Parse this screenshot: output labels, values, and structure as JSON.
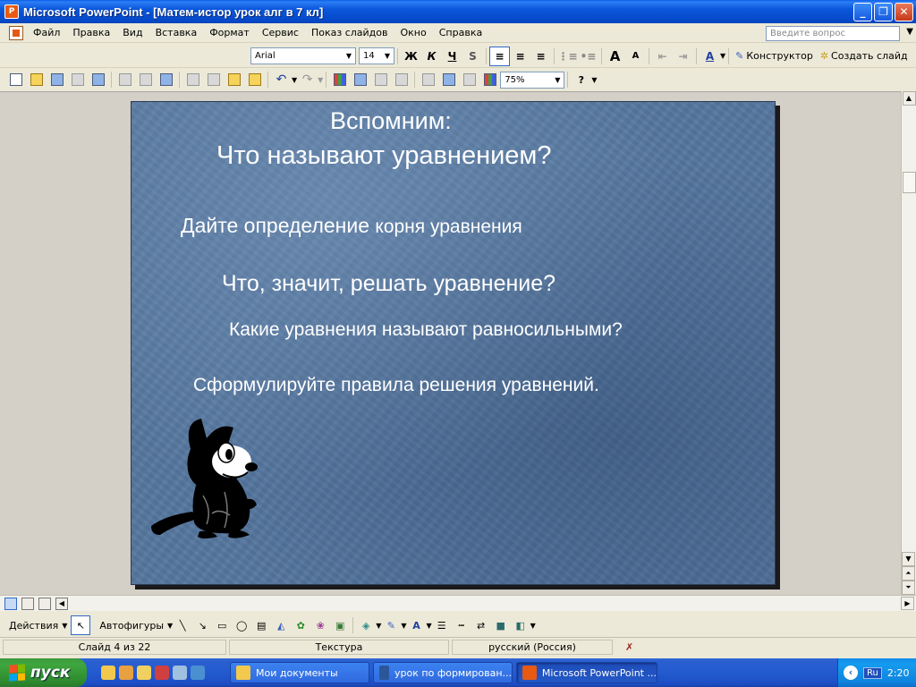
{
  "window": {
    "title": "Microsoft PowerPoint - [Матем-истор урок алг в 7 кл]",
    "buttons": {
      "minimize": "_",
      "maximize": "❐",
      "close": "✕"
    }
  },
  "menu": {
    "items": [
      "Файл",
      "Правка",
      "Вид",
      "Вставка",
      "Формат",
      "Сервис",
      "Показ слайдов",
      "Окно",
      "Справка"
    ],
    "help_placeholder": "Введите вопрос"
  },
  "format_toolbar": {
    "font": "Arial",
    "size": "14",
    "bold": "Ж",
    "italic": "К",
    "underline": "Ч",
    "shadow": "S",
    "font_color": "A",
    "designer": "Конструктор",
    "new_slide": "Создать слайд"
  },
  "standard_toolbar": {
    "zoom": "75%"
  },
  "slide": {
    "line1": "Вспомним:",
    "line2": "Что называют уравнением?",
    "line3_a": "Дайте определение ",
    "line3_b": "корня уравнения",
    "line4": "Что, значит, решать уравнение?",
    "line5": "Какие уравнения называют равносильными?",
    "line6": "Сформулируйте правила решения уравнений."
  },
  "drawing_toolbar": {
    "actions": "Действия",
    "autoshapes": "Автофигуры"
  },
  "status": {
    "slide": "Слайд 4 из 22",
    "design": "Текстура",
    "language": "русский (Россия)"
  },
  "taskbar": {
    "start": "пуск",
    "tasks": [
      "Мои документы",
      "урок по формирован...",
      "Microsoft PowerPoint ..."
    ],
    "lang": "Ru",
    "clock": "2:20"
  },
  "colors": {
    "slide_background": "#56779F",
    "title_bar": "#0A56DA",
    "taskbar": "#235BCF",
    "start_button": "#3FA63F"
  }
}
